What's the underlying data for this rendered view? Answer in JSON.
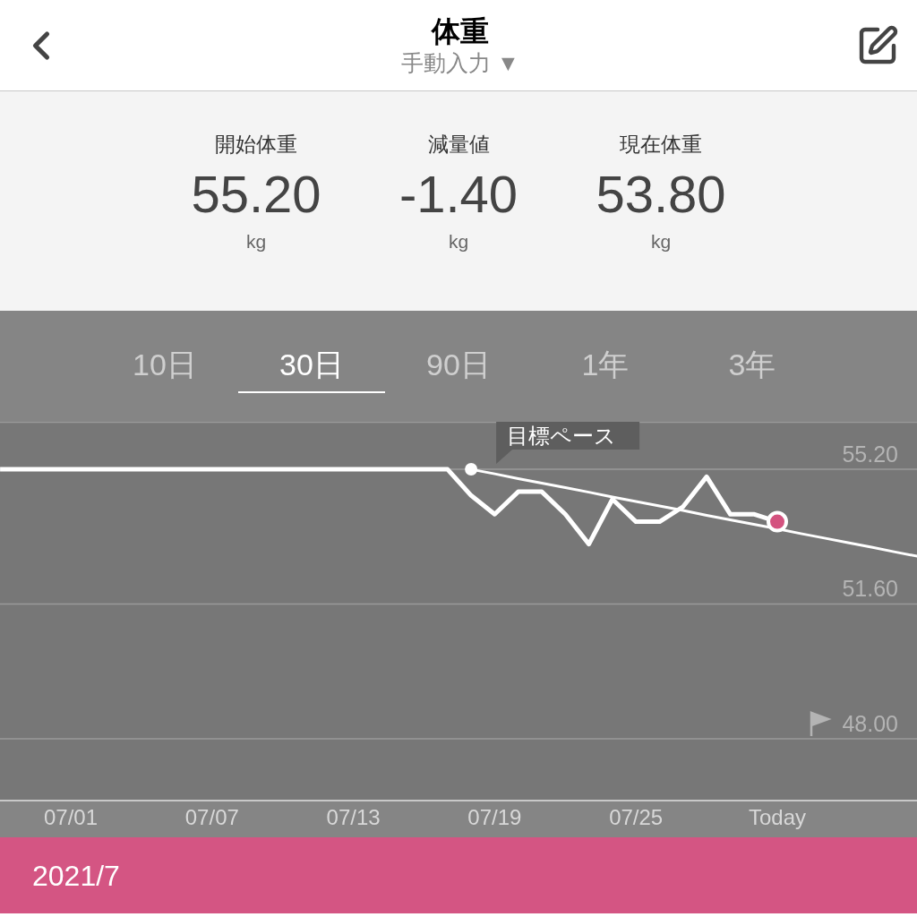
{
  "header": {
    "title": "体重",
    "subtitle": "手動入力 ▼"
  },
  "stats": [
    {
      "label": "開始体重",
      "value": "55.20",
      "unit": "kg"
    },
    {
      "label": "減量値",
      "value": "-1.40",
      "unit": "kg"
    },
    {
      "label": "現在体重",
      "value": "53.80",
      "unit": "kg"
    }
  ],
  "range_tabs": [
    {
      "label": "10日",
      "selected": false
    },
    {
      "label": "30日",
      "selected": true
    },
    {
      "label": "90日",
      "selected": false
    },
    {
      "label": "1年",
      "selected": false
    },
    {
      "label": "3年",
      "selected": false
    }
  ],
  "chart": {
    "chart_data": {
      "type": "line",
      "categories": [
        null,
        null,
        null,
        "07/01",
        null,
        null,
        null,
        null,
        null,
        "07/07",
        null,
        null,
        null,
        null,
        null,
        "07/13",
        null,
        null,
        null,
        null,
        null,
        "07/19",
        null,
        null,
        null,
        null,
        null,
        "07/25",
        null,
        null,
        null,
        null,
        null,
        "Today",
        null,
        null,
        null,
        null,
        null,
        null
      ],
      "series": [
        {
          "color": "#ffffff",
          "values": [
            55.2,
            55.2,
            55.2,
            55.2,
            55.2,
            55.2,
            55.2,
            55.2,
            55.2,
            55.2,
            55.2,
            55.2,
            55.2,
            55.2,
            55.2,
            55.2,
            55.2,
            55.2,
            55.2,
            55.2,
            54.5,
            54.0,
            54.6,
            54.6,
            54.0,
            53.2,
            54.4,
            53.8,
            53.8,
            54.2,
            55.0,
            54.0,
            54.0,
            53.8,
            null,
            null,
            null,
            null,
            null,
            null
          ]
        },
        {
          "name": "目標ペース",
          "color": "#ffffff",
          "values": [
            null,
            null,
            null,
            null,
            null,
            null,
            null,
            null,
            null,
            null,
            null,
            null,
            null,
            null,
            null,
            null,
            null,
            null,
            null,
            null,
            55.2,
            55.08,
            54.95,
            54.83,
            54.71,
            54.59,
            54.46,
            54.34,
            54.22,
            54.1,
            53.97,
            53.85,
            53.73,
            53.61,
            53.48,
            53.36,
            53.24,
            53.12,
            52.99,
            52.87
          ]
        }
      ],
      "ylim": [
        46.37,
        56.47
      ],
      "grid": true,
      "yticks": [
        {
          "value": 55.2,
          "label": "55.20"
        },
        {
          "value": 51.6,
          "label": "51.60"
        },
        {
          "value": 48.0,
          "label": "48.00"
        }
      ]
    }
  },
  "month_bar": {
    "label": "2021/7"
  }
}
